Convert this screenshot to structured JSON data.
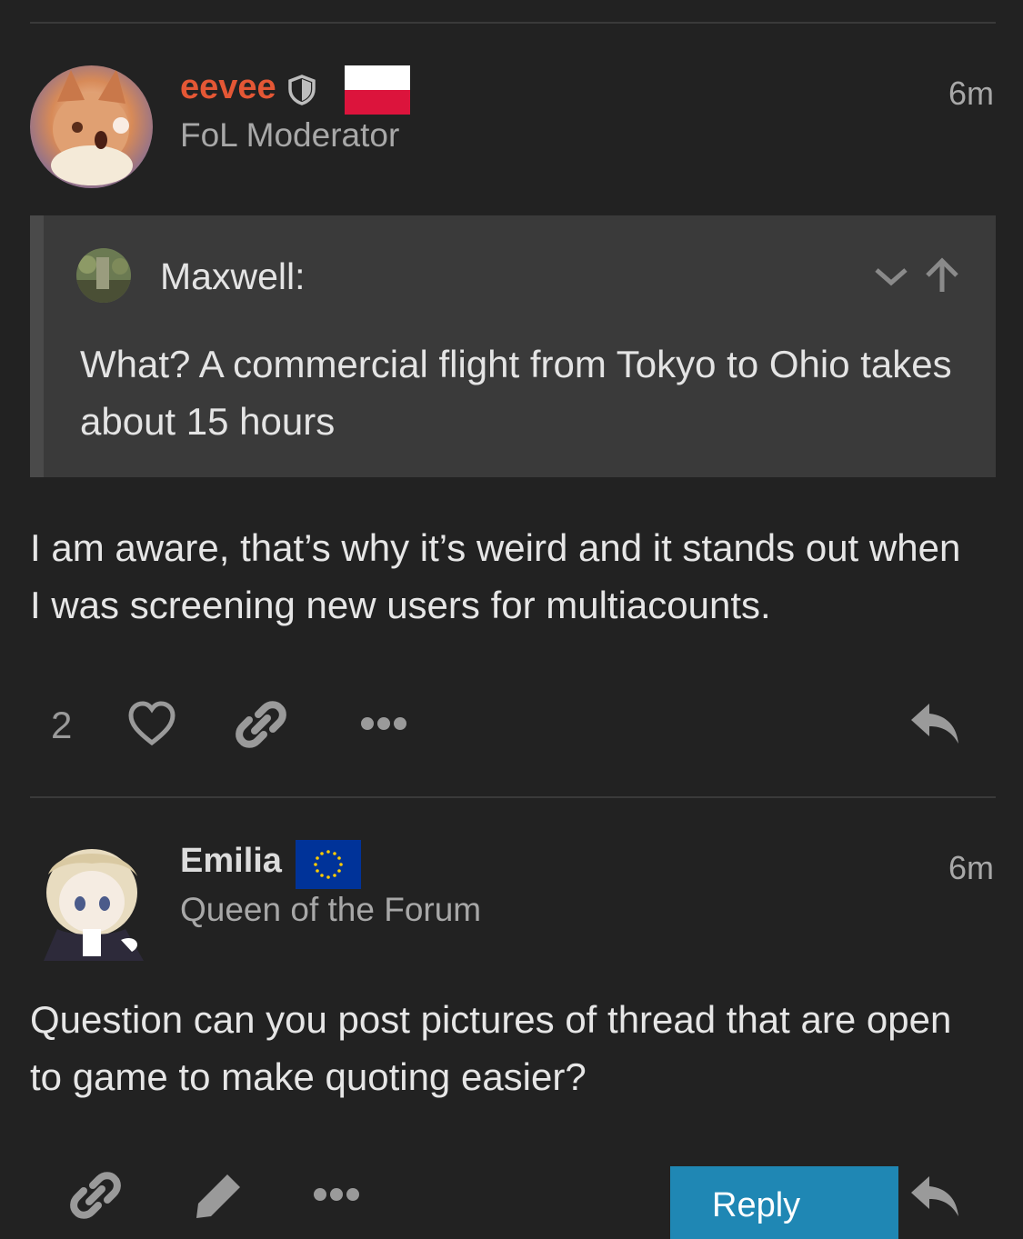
{
  "posts": [
    {
      "username": "eevee",
      "title": "FoL Moderator",
      "time": "6m",
      "quote": {
        "author": "Maxwell:",
        "text": "What? A commercial flight from Tokyo to Ohio takes about 15 hours"
      },
      "body": "I am aware, that’s why it’s weird and it stands out when I was screening new users for multiacounts.",
      "like_count": "2"
    },
    {
      "username": "Emilia",
      "title": "Queen of the Forum",
      "time": "6m",
      "body": "Question can you post pictures of thread that are open to game to make quoting easier?",
      "reply_label": "Reply"
    }
  ],
  "colors": {
    "background": "#222222",
    "moderator_name": "#e45735",
    "reply_button": "#1f87b4"
  },
  "icons": [
    "shield-icon",
    "poland-flag",
    "eu-flag",
    "chevron-down-icon",
    "arrow-up-icon",
    "heart-icon",
    "link-icon",
    "more-icon",
    "reply-icon",
    "edit-icon"
  ]
}
